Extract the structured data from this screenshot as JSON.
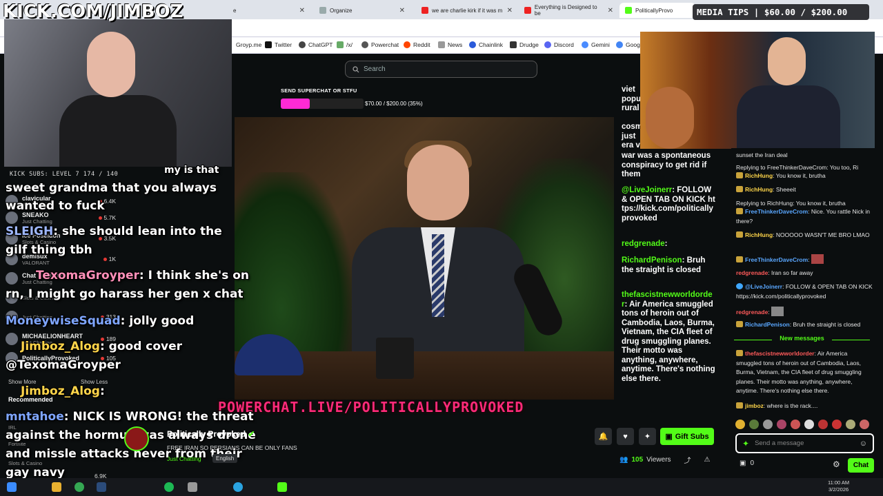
{
  "brand": {
    "title": "KICK.COM/JIMBOZ"
  },
  "browser": {
    "tabs": [
      {
        "label": "e"
      },
      {
        "label": "Organize"
      },
      {
        "label": "we are charlie kirk if it was m"
      },
      {
        "label": "Everything is Designed to be"
      },
      {
        "label": "PoliticallyProvo"
      }
    ],
    "bookmarks": [
      {
        "label": "Groyp.me"
      },
      {
        "label": "Twitter"
      },
      {
        "label": "ChatGPT"
      },
      {
        "label": "/x/"
      },
      {
        "label": "Powerchat"
      },
      {
        "label": "Reddit"
      },
      {
        "label": "News"
      },
      {
        "label": "Chainlink"
      },
      {
        "label": "Drudge"
      },
      {
        "label": "Discord"
      },
      {
        "label": "Gemini"
      },
      {
        "label": "Goog"
      }
    ]
  },
  "search": {
    "placeholder": "Search"
  },
  "goal": {
    "label": "SEND SUPERCHAT OR STFU",
    "text": "$70.00 / $200.00 (35%)",
    "fraction": 0.35
  },
  "media_tips": {
    "text": "MEDIA TIPS | $60.00 / $200.00"
  },
  "kick_subs": {
    "text": "KICK SUBS: LEVEL 7 174 / 140"
  },
  "powerchat_banner": "POWERCHAT.LIVE/POLITICALLYPROVOKED",
  "sidebar": {
    "channels": [
      {
        "name": "clavicular",
        "category": "Just Chatting",
        "viewers": "6.4K"
      },
      {
        "name": "SNEAKO",
        "category": "Just Chatting",
        "viewers": "5.7K"
      },
      {
        "name": "Ice Poseidon",
        "category": "Slots & Casino",
        "viewers": "3.5K"
      },
      {
        "name": "demisux",
        "category": "VALORANT",
        "viewers": "1K"
      },
      {
        "name": "Chat Roulette",
        "category": "Just Chatting",
        "viewers": ""
      },
      {
        "name": "",
        "category": "Slots & Casino",
        "viewers": ""
      },
      {
        "name": "",
        "category": "Just Chatting",
        "viewers": "313"
      },
      {
        "name": "MICHAELIONHEART",
        "category": "Just Chatting",
        "viewers": "189"
      },
      {
        "name": "PoliticallyProvoked",
        "category": "",
        "viewers": "105"
      }
    ],
    "show_more": "Show More",
    "show_less": "Show Less",
    "recommended": "Recommended",
    "bottom_channels": [
      {
        "name": "",
        "category": "IRL",
        "viewers": ""
      },
      {
        "name": "",
        "category": "Fortnite",
        "viewers": "4K"
      },
      {
        "name": "",
        "category": "Slots & Casino",
        "viewers": "6.9K"
      }
    ]
  },
  "overlay_chat": [
    {
      "user": "",
      "text": "my is that"
    },
    {
      "user": "",
      "text": "sweet grandma that you always"
    },
    {
      "user": "",
      "text": "wanted to fuck"
    },
    {
      "user": "SLEIGH",
      "text": "she should lean into the"
    },
    {
      "user": "",
      "text": "gilf thing tbh"
    },
    {
      "user": "TexomaGroyper",
      "text": "I think she's on"
    },
    {
      "user": "",
      "text": "rn, I might go harass her gen x chat"
    },
    {
      "user": "MoneywiseSquad",
      "text": "jolly good"
    },
    {
      "user": "Jimboz_Alog",
      "text": "good cover"
    },
    {
      "user": "",
      "text": "@TexomaGroyper"
    },
    {
      "user": "Jimboz_Alog",
      "text": ""
    },
    {
      "user": "mntahoe",
      "text": "NICK IS WRONG! the threat"
    },
    {
      "user": "",
      "text": "against the hormuz was always drone"
    },
    {
      "user": "",
      "text": "and missle attacks never from their"
    },
    {
      "user": "",
      "text": "gay navy"
    }
  ],
  "mid_chat": [
    {
      "user": "",
      "text": "viet popu rural"
    },
    {
      "user": "",
      "text": "cosm just era v"
    },
    {
      "user": "",
      "text": "war was a spontaneous conspiracy to get rid if them"
    },
    {
      "user": "@LiveJoinerr",
      "text": "FOLLOW & OPEN TAB ON KICK https://kick.com/politicallyprovoked"
    },
    {
      "user": "redgrenade",
      "text": ""
    },
    {
      "user": "RichardPenison",
      "text": "Bruh the straight is closed"
    },
    {
      "user": "thefascistnewworldorder",
      "text": "Air America smuggled tons of heroin out of Cambodia, Laos, Burma, Vietnam, the CIA fleet of drug smuggling planes. Their motto was anything, anywhere, anytime. There's nothing else there."
    }
  ],
  "right_chat": [
    {
      "reply": "",
      "user": "",
      "text": "sunset the Iran deal",
      "color": "#e6e6e6"
    },
    {
      "reply": "Replying to FreeThinkerDaveCrom: You too, Ri",
      "user": "RichHung",
      "text": "You know it, brutha",
      "color": "#ffd54a"
    },
    {
      "reply": "",
      "user": "RichHung",
      "text": "Sheeeit",
      "color": "#ffd54a"
    },
    {
      "reply": "Replying to RichHung: You know it, brutha",
      "user": "FreeThinkerDaveCrom",
      "text": "Nice. You rattle Nick in there?",
      "color": "#5aa7ff"
    },
    {
      "reply": "",
      "user": "RichHung",
      "text": "NOOOOO WASN'T ME BRO LMAO",
      "color": "#ffd54a"
    },
    {
      "reply": "",
      "user": "FreeThinkerDaveCrom",
      "text": "",
      "color": "#5aa7ff"
    },
    {
      "reply": "",
      "user": "redgrenade",
      "text": "Iran so far away",
      "color": "#ff5a5a"
    },
    {
      "reply": "",
      "user": "@LiveJoinerr",
      "text": "FOLLOW & OPEN TAB ON KICK https://kick.com/politicallyprovoked",
      "color": "#5aa7ff"
    },
    {
      "reply": "",
      "user": "redgrenade",
      "text": "",
      "color": "#ff5a5a"
    },
    {
      "reply": "",
      "user": "RichardPenison",
      "text": "Bruh the straight is closed",
      "color": "#5aa7ff"
    }
  ],
  "new_messages": "New messages",
  "right_chat_new": [
    {
      "user": "thefascistnewworldorder",
      "text": "Air America smuggled tons of heroin out of Cambodia, Laos, Burma, Vietnam, the CIA fleet of drug smuggling planes. Their motto was anything, anywhere, anytime. There's nothing else there.",
      "color": "#ff5a5a"
    },
    {
      "user": "jimboz",
      "text": "where is the rack....",
      "color": "#ffd54a"
    }
  ],
  "chat_input": {
    "placeholder": "Send a message",
    "count": "0",
    "send_label": "Chat"
  },
  "channel": {
    "name": "Politically Provoked",
    "title": "FREE IRAN SO PERSIANS CAN BE ONLY FANS",
    "category": "Just Chatting",
    "language": "English",
    "viewers": "105",
    "viewers_label": "Viewers",
    "gift_subs": "Gift Subs"
  },
  "taskbar": {
    "time": "11:00 AM",
    "date": "3/2/2026"
  },
  "colors": {
    "kick_green": "#53fc18",
    "goal_pink": "#ff2ad4",
    "banner_pink": "#ff2a7a"
  }
}
